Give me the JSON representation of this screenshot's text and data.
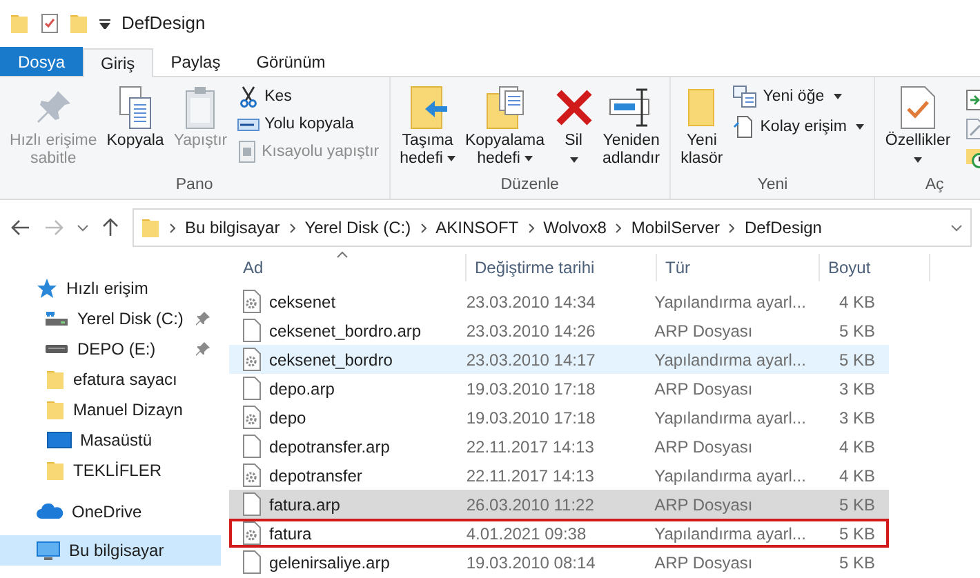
{
  "window": {
    "title": "DefDesign"
  },
  "ribbon_tabs": [
    {
      "label": "Dosya",
      "kind": "file",
      "selected": false
    },
    {
      "label": "Giriş",
      "kind": "tab",
      "selected": true
    },
    {
      "label": "Paylaş",
      "kind": "tab",
      "selected": false
    },
    {
      "label": "Görünüm",
      "kind": "tab",
      "selected": false
    }
  ],
  "ribbon_groups": [
    {
      "label": "Pano",
      "large": [
        {
          "label": "Hızlı erişime sabitle",
          "disabled": true,
          "dropdown": false
        },
        {
          "label": "Kopyala",
          "disabled": false,
          "dropdown": false
        },
        {
          "label": "Yapıştır",
          "disabled": true,
          "dropdown": false
        }
      ],
      "small": [
        {
          "label": "Kes",
          "disabled": false,
          "dropdown": false
        },
        {
          "label": "Yolu kopyala",
          "disabled": false,
          "dropdown": false
        },
        {
          "label": "Kısayolu yapıştır",
          "disabled": true,
          "dropdown": false
        }
      ]
    },
    {
      "label": "Düzenle",
      "large": [
        {
          "label": "Taşıma hedefi",
          "disabled": false,
          "dropdown": true
        },
        {
          "label": "Kopyalama hedefi",
          "disabled": false,
          "dropdown": true
        },
        {
          "label": "Sil",
          "disabled": false,
          "dropdown": true
        },
        {
          "label": "Yeniden adlandır",
          "disabled": false,
          "dropdown": false
        }
      ]
    },
    {
      "label": "Yeni",
      "large": [
        {
          "label": "Yeni klasör",
          "disabled": false,
          "dropdown": false
        }
      ],
      "small": [
        {
          "label": "Yeni öğe",
          "disabled": false,
          "dropdown": true
        },
        {
          "label": "Kolay erişim",
          "disabled": false,
          "dropdown": true
        }
      ]
    },
    {
      "label": "Aç",
      "large": [
        {
          "label": "Özellikler",
          "disabled": false,
          "dropdown": true
        }
      ]
    }
  ],
  "breadcrumb": [
    "Bu bilgisayar",
    "Yerel Disk (C:)",
    "AKINSOFT",
    "Wolvox8",
    "MobilServer",
    "DefDesign"
  ],
  "sidebar": {
    "items": [
      {
        "label": "Hızlı erişim",
        "kind": "star",
        "pinned": false,
        "selected": false
      },
      {
        "label": "Yerel Disk (C:)",
        "kind": "disk",
        "pinned": true,
        "selected": false
      },
      {
        "label": "DEPO (E:)",
        "kind": "drive",
        "pinned": true,
        "selected": false
      },
      {
        "label": "efatura sayacı",
        "kind": "folder",
        "pinned": false,
        "selected": false
      },
      {
        "label": "Manuel Dizayn",
        "kind": "folder",
        "pinned": false,
        "selected": false
      },
      {
        "label": "Masaüstü",
        "kind": "desktop",
        "pinned": false,
        "selected": false
      },
      {
        "label": "TEKLİFLER",
        "kind": "folder",
        "pinned": false,
        "selected": false
      },
      {
        "label": "OneDrive",
        "kind": "cloud",
        "pinned": false,
        "selected": false
      },
      {
        "label": "Bu bilgisayar",
        "kind": "computer",
        "pinned": false,
        "selected": true
      }
    ]
  },
  "table": {
    "columns": [
      "Ad",
      "Değiştirme tarihi",
      "Tür",
      "Boyut"
    ],
    "rows": [
      {
        "name": "ceksenet",
        "date": "23.03.2010 14:34",
        "type": "Yapılandırma ayarl...",
        "size": "4 KB",
        "kind": "config",
        "selected": false,
        "hovered": false,
        "outlined": false
      },
      {
        "name": "ceksenet_bordro.arp",
        "date": "23.03.2010 14:26",
        "type": "ARP Dosyası",
        "size": "5 KB",
        "kind": "file",
        "selected": false,
        "hovered": false,
        "outlined": false
      },
      {
        "name": "ceksenet_bordro",
        "date": "23.03.2010 14:17",
        "type": "Yapılandırma ayarl...",
        "size": "5 KB",
        "kind": "config",
        "selected": false,
        "hovered": true,
        "outlined": false
      },
      {
        "name": "depo.arp",
        "date": "19.03.2010 17:18",
        "type": "ARP Dosyası",
        "size": "3 KB",
        "kind": "file",
        "selected": false,
        "hovered": false,
        "outlined": false
      },
      {
        "name": "depo",
        "date": "19.03.2010 17:18",
        "type": "Yapılandırma ayarl...",
        "size": "3 KB",
        "kind": "config",
        "selected": false,
        "hovered": false,
        "outlined": false
      },
      {
        "name": "depotransfer.arp",
        "date": "22.11.2017 14:13",
        "type": "ARP Dosyası",
        "size": "4 KB",
        "kind": "file",
        "selected": false,
        "hovered": false,
        "outlined": false
      },
      {
        "name": "depotransfer",
        "date": "22.11.2017 14:13",
        "type": "Yapılandırma ayarl...",
        "size": "4 KB",
        "kind": "config",
        "selected": false,
        "hovered": false,
        "outlined": false
      },
      {
        "name": "fatura.arp",
        "date": "26.03.2010 11:22",
        "type": "ARP Dosyası",
        "size": "5 KB",
        "kind": "file",
        "selected": true,
        "hovered": false,
        "outlined": false
      },
      {
        "name": "fatura",
        "date": "4.01.2021 09:38",
        "type": "Yapılandırma ayarl...",
        "size": "5 KB",
        "kind": "config",
        "selected": false,
        "hovered": false,
        "outlined": true
      },
      {
        "name": "gelenirsaliye.arp",
        "date": "19.03.2010 08:14",
        "type": "ARP Dosyası",
        "size": "5 KB",
        "kind": "file",
        "selected": false,
        "hovered": false,
        "outlined": false
      }
    ]
  }
}
